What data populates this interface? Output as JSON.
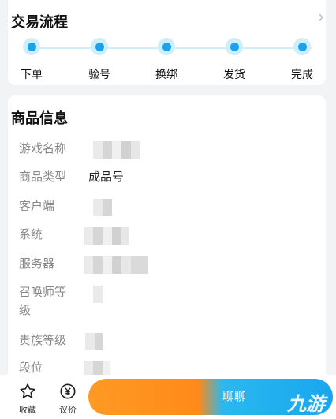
{
  "process": {
    "title": "交易流程",
    "steps": [
      "下单",
      "验号",
      "换绑",
      "发货",
      "完成"
    ]
  },
  "info": {
    "title": "商品信息",
    "rows": [
      {
        "label": "游戏名称",
        "value": ""
      },
      {
        "label": "商品类型",
        "value": "成品号"
      },
      {
        "label": "客户端",
        "value": ""
      },
      {
        "label": "系统",
        "value": ""
      },
      {
        "label": "服务器",
        "value": ""
      },
      {
        "label": "召唤师等级",
        "value": ""
      },
      {
        "label": "贵族等级",
        "value": ""
      },
      {
        "label": "段位",
        "value": ""
      }
    ]
  },
  "bottom": {
    "favorite_label": "收藏",
    "bargain_label": "议价",
    "chat_label": "聊聊"
  },
  "watermark": "九游",
  "colors": {
    "accent": "#1aa2ee",
    "orange": "#ff9a24"
  }
}
